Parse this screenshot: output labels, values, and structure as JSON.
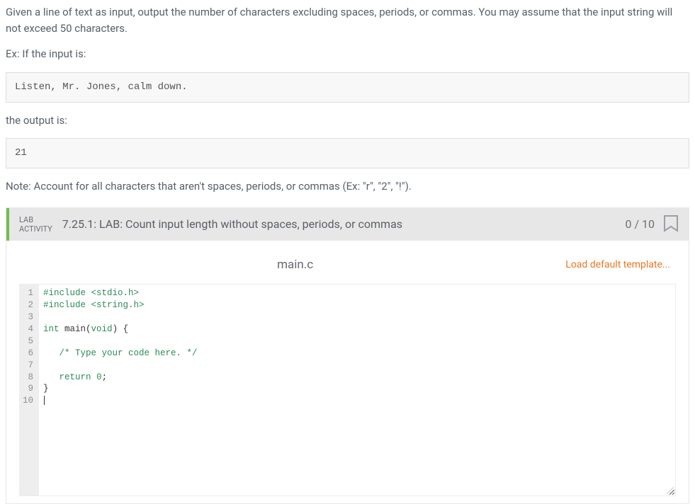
{
  "problem": {
    "intro": "Given a line of text as input, output the number of characters excluding spaces, periods, or commas. You may assume that the input string will not exceed 50 characters.",
    "ex_label": "Ex: If the input is:",
    "sample_input": "Listen, Mr. Jones, calm down.",
    "output_label": "the output is:",
    "sample_output": "21",
    "note": "Note: Account for all characters that aren't spaces, periods, or commas (Ex: \"r\", \"2\", \"!\")."
  },
  "lab": {
    "activity_label_line1": "LAB",
    "activity_label_line2": "ACTIVITY",
    "title": "7.25.1: LAB: Count input length without spaces, periods, or commas",
    "score": "0 / 10",
    "filename": "main.c",
    "load_template": "Load default template..."
  },
  "editor": {
    "lines": [
      {
        "n": 1,
        "tokens": [
          [
            "inc",
            "#include "
          ],
          [
            "inc",
            "<stdio.h>"
          ]
        ]
      },
      {
        "n": 2,
        "tokens": [
          [
            "inc",
            "#include "
          ],
          [
            "inc",
            "<string.h>"
          ]
        ]
      },
      {
        "n": 3,
        "tokens": []
      },
      {
        "n": 4,
        "tokens": [
          [
            "type",
            "int"
          ],
          [
            "plain",
            " main("
          ],
          [
            "type",
            "void"
          ],
          [
            "plain",
            ") {"
          ]
        ]
      },
      {
        "n": 5,
        "tokens": []
      },
      {
        "n": 6,
        "tokens": [
          [
            "plain",
            "   "
          ],
          [
            "cmt",
            "/* Type your code here. */"
          ]
        ]
      },
      {
        "n": 7,
        "tokens": []
      },
      {
        "n": 8,
        "tokens": [
          [
            "plain",
            "   "
          ],
          [
            "type",
            "return"
          ],
          [
            "plain",
            " "
          ],
          [
            "num",
            "0"
          ],
          [
            "plain",
            ";"
          ]
        ]
      },
      {
        "n": 9,
        "tokens": [
          [
            "plain",
            "}"
          ]
        ]
      },
      {
        "n": 10,
        "tokens": [],
        "cursor": true
      }
    ]
  }
}
